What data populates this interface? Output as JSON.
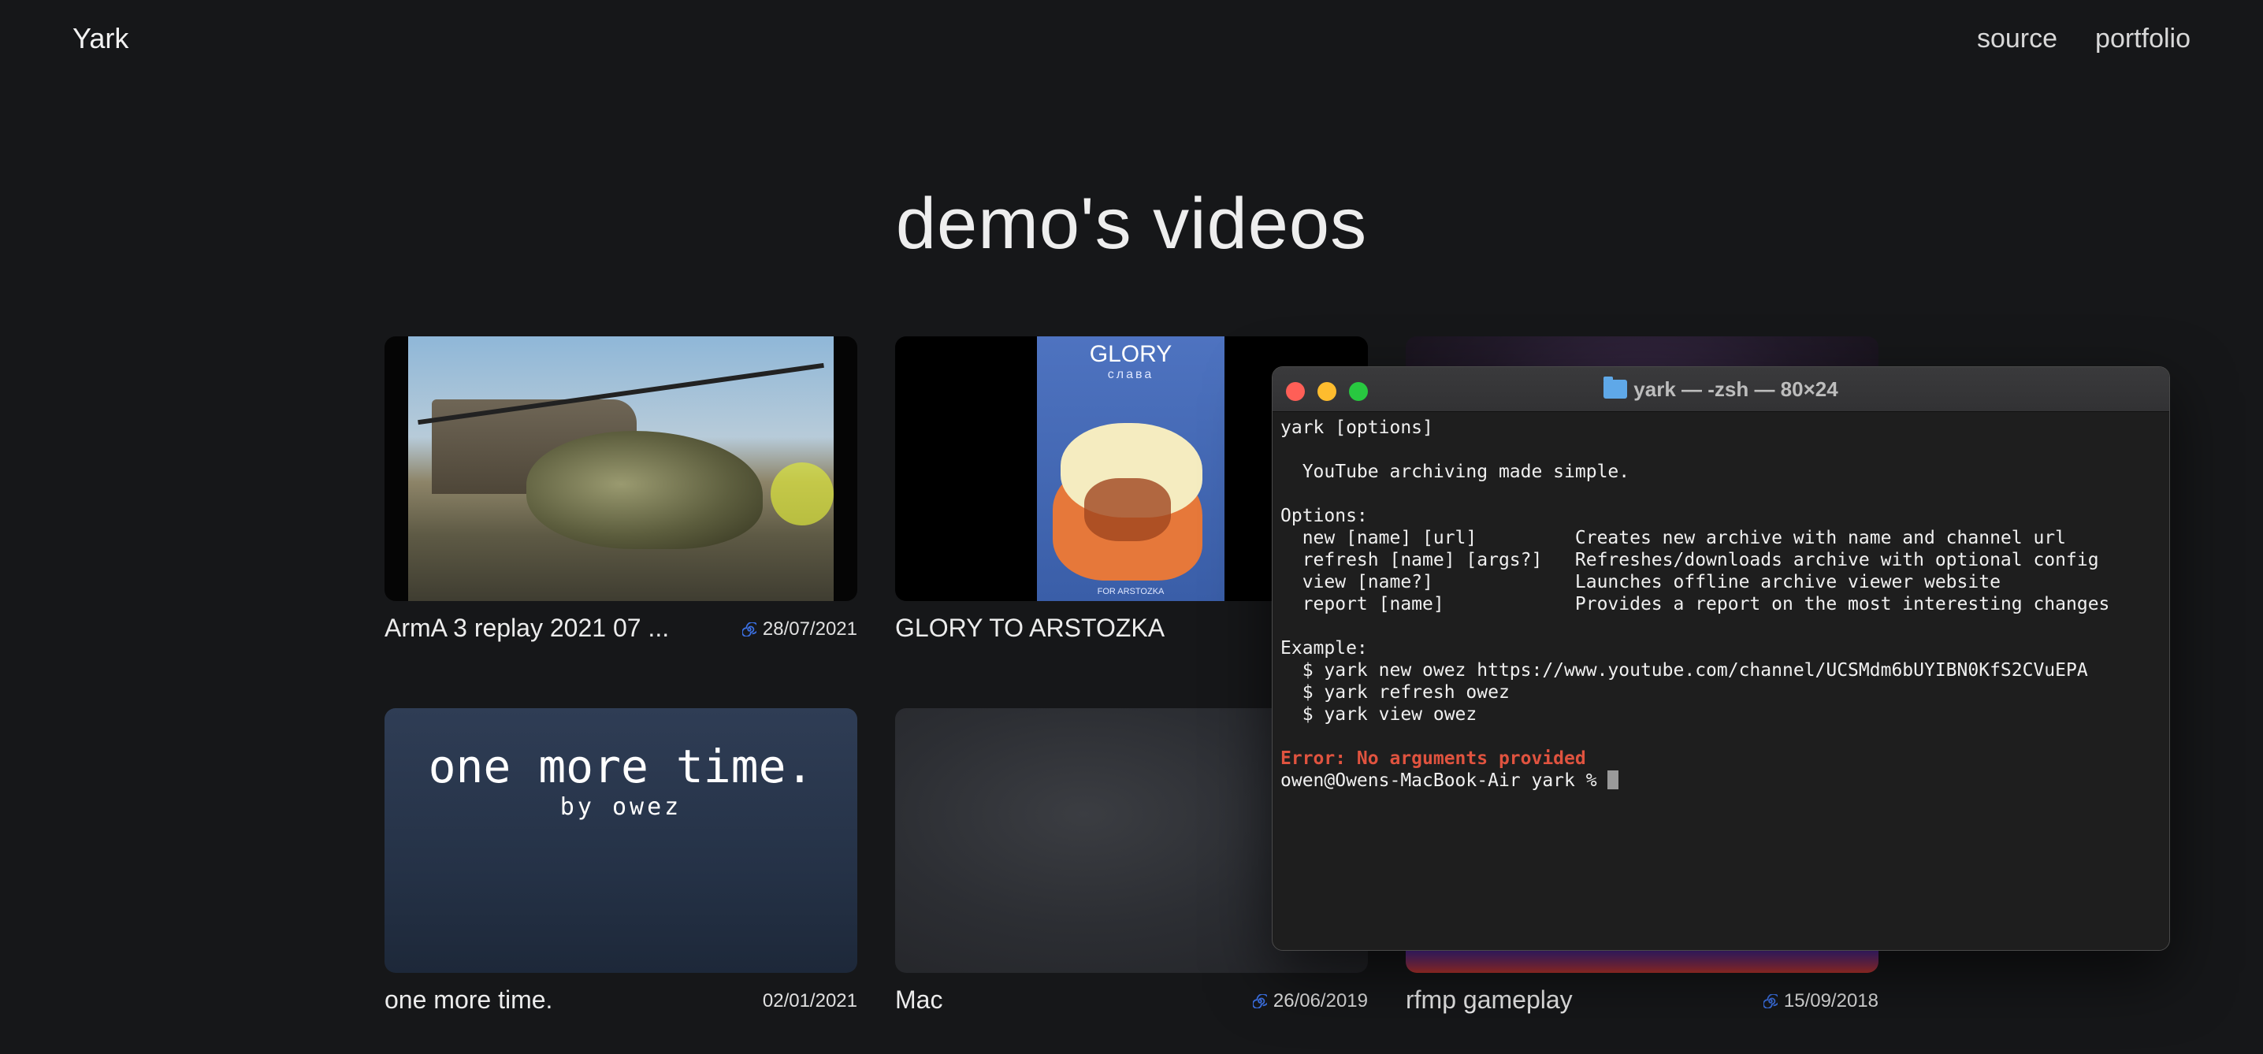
{
  "header": {
    "brand": "Yark",
    "nav": [
      "source",
      "portfolio"
    ]
  },
  "page_title": "demo's videos",
  "videos": [
    {
      "title": "ArmA 3 replay 2021 07 ...",
      "date": "28/07/2021",
      "has_icon": true
    },
    {
      "title": "GLORY TO ARSTOZKA",
      "date": "",
      "has_icon": false
    },
    {
      "title": "",
      "date": "",
      "has_icon": false
    },
    {
      "title": "one more time.",
      "date": "02/01/2021",
      "has_icon": false
    },
    {
      "title": "Mac",
      "date": "26/06/2019",
      "has_icon": true
    },
    {
      "title": "rfmp gameplay",
      "date": "15/09/2018",
      "has_icon": true
    }
  ],
  "thumbs": {
    "glory_title": "GLORY",
    "glory_sub": "слава",
    "glory_foot": "FOR ARSTOZKA",
    "omt_big": "one more time.",
    "omt_small": "by owez"
  },
  "terminal": {
    "title": "yark — -zsh — 80×24",
    "lines": [
      {
        "text": "yark [options]",
        "style": "normal"
      },
      {
        "text": "",
        "style": "normal"
      },
      {
        "text": "  YouTube archiving made simple.",
        "style": "normal"
      },
      {
        "text": "",
        "style": "normal"
      },
      {
        "text": "Options:",
        "style": "normal"
      },
      {
        "text": "  new [name] [url]         Creates new archive with name and channel url",
        "style": "normal"
      },
      {
        "text": "  refresh [name] [args?]   Refreshes/downloads archive with optional config",
        "style": "normal"
      },
      {
        "text": "  view [name?]             Launches offline archive viewer website",
        "style": "normal"
      },
      {
        "text": "  report [name]            Provides a report on the most interesting changes",
        "style": "normal"
      },
      {
        "text": "",
        "style": "normal"
      },
      {
        "text": "Example:",
        "style": "normal"
      },
      {
        "text": "  $ yark new owez https://www.youtube.com/channel/UCSMdm6bUYIBN0KfS2CVuEPA",
        "style": "normal"
      },
      {
        "text": "  $ yark refresh owez",
        "style": "normal"
      },
      {
        "text": "  $ yark view owez",
        "style": "normal"
      },
      {
        "text": "",
        "style": "normal"
      },
      {
        "text": "Error: No arguments provided",
        "style": "error"
      }
    ],
    "prompt": "owen@Owens-MacBook-Air yark % "
  },
  "colors": {
    "background": "#161719",
    "error": "#e0533f",
    "spiral": "#3b6fe0"
  }
}
